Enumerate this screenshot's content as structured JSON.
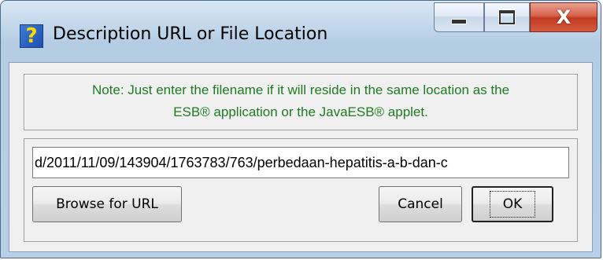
{
  "window": {
    "title": "Description URL or File Location",
    "icon": "help-question-icon"
  },
  "caption_buttons": {
    "minimize_icon": "minimize-icon",
    "maximize_icon": "maximize-icon",
    "close_glyph": "X"
  },
  "note": {
    "line1": "Note: Just enter the filename if it will reside in the same location as the",
    "line2": "ESB® application or the JavaESB® applet."
  },
  "url_field": {
    "value": "d/2011/11/09/143904/1763783/763/perbedaan-hepatitis-a-b-dan-c"
  },
  "buttons": {
    "browse": "Browse for URL",
    "cancel": "Cancel",
    "ok": "OK"
  },
  "colors": {
    "note_text": "#1f7a22",
    "close_button": "#c13a22"
  }
}
